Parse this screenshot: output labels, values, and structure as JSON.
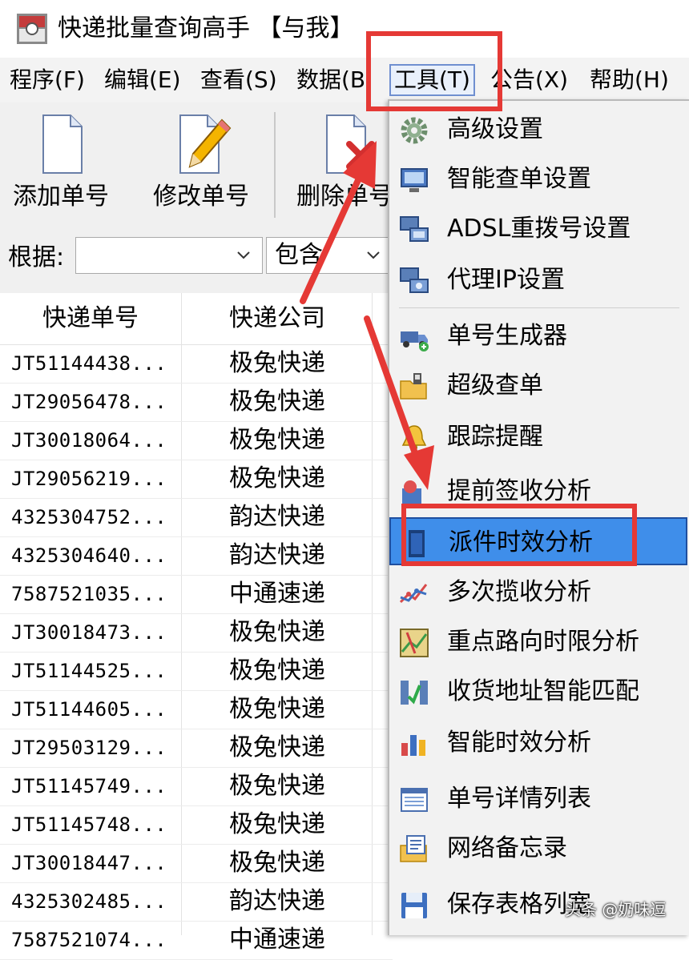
{
  "window": {
    "title": "快递批量查询高手 【与我】"
  },
  "menubar": {
    "items": [
      {
        "label": "程序(F)"
      },
      {
        "label": "编辑(E)"
      },
      {
        "label": "查看(S)"
      },
      {
        "label": "数据(B"
      },
      {
        "label": "工具(T)"
      },
      {
        "label": "公告(X)"
      },
      {
        "label": "帮助(H)"
      }
    ]
  },
  "toolbar": {
    "add_label": "添加单号",
    "edit_label": "修改单号",
    "delete_label": "删除单号"
  },
  "filter": {
    "label": "根据:",
    "field_value": "",
    "match_value": "包含"
  },
  "table": {
    "columns": [
      "快递单号",
      "快递公司"
    ],
    "rows": [
      {
        "no": "JT51144438...",
        "company": "极兔快递"
      },
      {
        "no": "JT29056478...",
        "company": "极兔快递"
      },
      {
        "no": "JT30018064...",
        "company": "极兔快递"
      },
      {
        "no": "JT29056219...",
        "company": "极兔快递"
      },
      {
        "no": "4325304752...",
        "company": "韵达快递"
      },
      {
        "no": "4325304640...",
        "company": "韵达快递"
      },
      {
        "no": "7587521035...",
        "company": "中通速递"
      },
      {
        "no": "JT30018473...",
        "company": "极兔快递"
      },
      {
        "no": "JT51144525...",
        "company": "极兔快递"
      },
      {
        "no": "JT51144605...",
        "company": "极兔快递"
      },
      {
        "no": "JT29503129...",
        "company": "极兔快递"
      },
      {
        "no": "JT51145749...",
        "company": "极兔快递"
      },
      {
        "no": "JT51145748...",
        "company": "极兔快递"
      },
      {
        "no": "JT30018447...",
        "company": "极兔快递"
      },
      {
        "no": "4325302485...",
        "company": "韵达快递"
      },
      {
        "no": "7587521074...",
        "company": "中通速递"
      }
    ]
  },
  "tools_menu": {
    "items": [
      {
        "label": "高级设置",
        "icon": "gear-icon"
      },
      {
        "label": "智能查单设置",
        "icon": "monitor-icon"
      },
      {
        "label": "ADSL重拨号设置",
        "icon": "network-icon"
      },
      {
        "label": "代理IP设置",
        "icon": "proxy-icon"
      },
      {
        "label": "单号生成器",
        "icon": "truck-icon"
      },
      {
        "label": "超级查单",
        "icon": "folder-search-icon"
      },
      {
        "label": "跟踪提醒",
        "icon": "bell-icon"
      },
      {
        "label": "提前签收分析",
        "icon": "analysis-icon"
      },
      {
        "label": "派件时效分析",
        "icon": "delivery-chart-icon",
        "highlighted": true
      },
      {
        "label": "多次揽收分析",
        "icon": "line-chart-icon"
      },
      {
        "label": "重点路向时限分析",
        "icon": "map-icon"
      },
      {
        "label": "收货地址智能匹配",
        "icon": "match-icon"
      },
      {
        "label": "智能时效分析",
        "icon": "bar-chart-icon"
      },
      {
        "label": "单号详情列表",
        "icon": "list-icon"
      },
      {
        "label": "网络备忘录",
        "icon": "memo-icon"
      },
      {
        "label": "保存表格列宽",
        "icon": "save-icon"
      }
    ]
  },
  "watermark": {
    "text": "头条 @奶味逗"
  },
  "colors": {
    "highlight": "#3f8eea",
    "annotation_red": "#e53935",
    "menu_bg": "#f2f2f2"
  }
}
